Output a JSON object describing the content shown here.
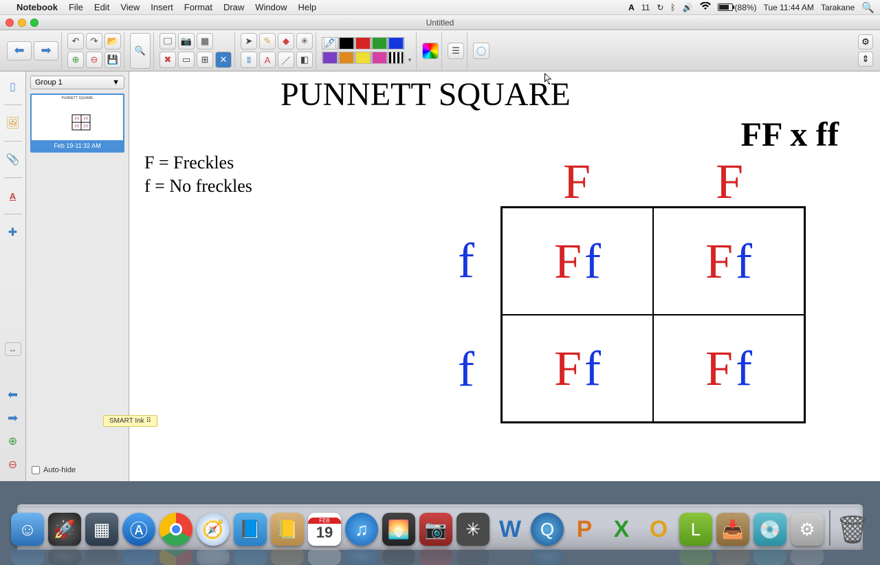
{
  "menubar": {
    "app": "Notebook",
    "items": [
      "File",
      "Edit",
      "View",
      "Insert",
      "Format",
      "Draw",
      "Window",
      "Help"
    ],
    "ai_badge": "11",
    "battery_pct": "(88%)",
    "time": "Tue 11:44 AM",
    "user": "Tarakane"
  },
  "window": {
    "title": "Untitled"
  },
  "toolbar": {
    "gear_icon": "gear-icon"
  },
  "sidebar": {
    "group_label": "Group 1",
    "slide1_timestamp": "Feb 19-11:32 AM",
    "auto_hide_label": "Auto-hide",
    "smart_ink_label": "SMART Ink"
  },
  "canvas": {
    "title": "PUNNETT SQUARE",
    "cross": "FF x ff",
    "key1": "F = Freckles",
    "key2": "f = No freckles",
    "col_headers": [
      "F",
      "F"
    ],
    "row_headers": [
      "f",
      "f"
    ],
    "cells": [
      [
        "Ff",
        "Ff"
      ],
      [
        "Ff",
        "Ff"
      ]
    ]
  },
  "dock": {
    "calendar_day": "19",
    "calendar_month": "FEB"
  }
}
